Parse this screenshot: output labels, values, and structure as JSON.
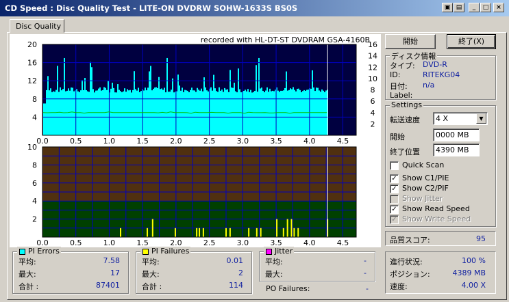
{
  "window": {
    "title": "CD Speed : Disc Quality Test - LITE-ON DVDRW SOHW-1633S BS0S",
    "help_btn": "▣",
    "min_btn": "_",
    "max_btn": "□",
    "close_btn": "×"
  },
  "tabs": {
    "active": "Disc Quality"
  },
  "chart": {
    "recorded": "recorded with HL-DT-ST DVDRAM GSA-4160B",
    "colors": {
      "top_bg": "#000040",
      "pie": "#00ffff",
      "read_speed": "#00c000",
      "grid": "#0000c0",
      "bottom_brown": "#503010",
      "bottom_green": "#004000",
      "pif": "#ffff00",
      "end_marker": "#ffffff"
    }
  },
  "chart_data": [
    {
      "type": "bar",
      "name": "PI Errors",
      "x_ticks": [
        "0.0",
        "0.5",
        "1.0",
        "1.5",
        "2.0",
        "2.5",
        "3.0",
        "3.5",
        "4.0",
        "4.5"
      ],
      "y_left_ticks": [
        "20",
        "16",
        "12",
        "8",
        "4"
      ],
      "y_right_ticks": [
        "16",
        "14",
        "12",
        "10",
        "8",
        "6",
        "4",
        "2"
      ],
      "xlim": [
        0,
        4.7
      ],
      "ylim": [
        0,
        20
      ],
      "y2lim": [
        0,
        16
      ],
      "data_end": 4.27,
      "pie_baseline": 10,
      "pie_max": 17,
      "read_speed": 4.0,
      "grid": true
    },
    {
      "type": "bar",
      "name": "PI Failures",
      "x_ticks": [
        "0.0",
        "0.5",
        "1.0",
        "1.5",
        "2.0",
        "2.5",
        "3.0",
        "3.5",
        "4.0",
        "4.5"
      ],
      "y_ticks": [
        "10",
        "8",
        "6",
        "4",
        "2"
      ],
      "xlim": [
        0,
        4.7
      ],
      "ylim": [
        0,
        10
      ],
      "threshold": 4,
      "data_end": 4.27,
      "spikes": [
        [
          1.16,
          1
        ],
        [
          1.56,
          1
        ],
        [
          1.64,
          2
        ],
        [
          1.98,
          1
        ],
        [
          2.3,
          1
        ],
        [
          2.34,
          1
        ],
        [
          2.4,
          1
        ],
        [
          2.74,
          1
        ],
        [
          2.8,
          1
        ],
        [
          3.08,
          1
        ],
        [
          3.2,
          1
        ],
        [
          3.26,
          1
        ],
        [
          3.5,
          2
        ],
        [
          3.6,
          1
        ],
        [
          3.66,
          2
        ],
        [
          3.72,
          2
        ],
        [
          3.76,
          1
        ],
        [
          3.82,
          1
        ],
        [
          4.26,
          2
        ]
      ],
      "grid": true
    }
  ],
  "controls": {
    "start_btn": "開始",
    "exit_btn": "終了(X)"
  },
  "disc_info": {
    "title": "ディスク情報",
    "type_label": "タイプ:",
    "type_value": "DVD-R",
    "id_label": "ID:",
    "id_value": "RITEKG04",
    "date_label": "日付:",
    "date_value": "n/a",
    "label_label": "Label:",
    "label_value": ""
  },
  "settings": {
    "title": "Settings",
    "speed_label": "転送速度",
    "speed_value": "4 X",
    "start_label": "開始",
    "start_value": "0000 MB",
    "end_label": "終了位置",
    "end_value": "4390 MB",
    "checkboxes": [
      {
        "label": "Quick Scan",
        "checked": false,
        "disabled": false
      },
      {
        "label": "Show C1/PIE",
        "checked": true,
        "disabled": false
      },
      {
        "label": "Show C2/PIF",
        "checked": true,
        "disabled": false
      },
      {
        "label": "Show Jitter",
        "checked": false,
        "disabled": true
      },
      {
        "label": "Show Read Speed",
        "checked": true,
        "disabled": false
      },
      {
        "label": "Show Write Speed",
        "checked": true,
        "disabled": true
      }
    ]
  },
  "quality": {
    "label": "品質スコア:",
    "value": "95"
  },
  "progress": {
    "progress_label": "進行状況:",
    "progress_value": "100 %",
    "position_label": "ポジション:",
    "position_value": "4389 MB",
    "speed_label": "速度:",
    "speed_value": "4.00 X"
  },
  "pi_errors": {
    "title": "PI Errors",
    "color": "#00ffff",
    "avg_label": "平均:",
    "avg_value": "7.58",
    "max_label": "最大:",
    "max_value": "17",
    "total_label": "合計 :",
    "total_value": "87401"
  },
  "pi_failures": {
    "title": "PI Failures",
    "color": "#ffff00",
    "avg_label": "平均:",
    "avg_value": "0.01",
    "max_label": "最大:",
    "max_value": "2",
    "total_label": "合計 :",
    "total_value": "114"
  },
  "jitter": {
    "title": "Jitter",
    "color": "#ff00ff",
    "avg_label": "平均:",
    "avg_value": "-",
    "max_label": "最大:",
    "max_value": "-"
  },
  "po_failures": {
    "label": "PO Failures:",
    "value": "-"
  }
}
